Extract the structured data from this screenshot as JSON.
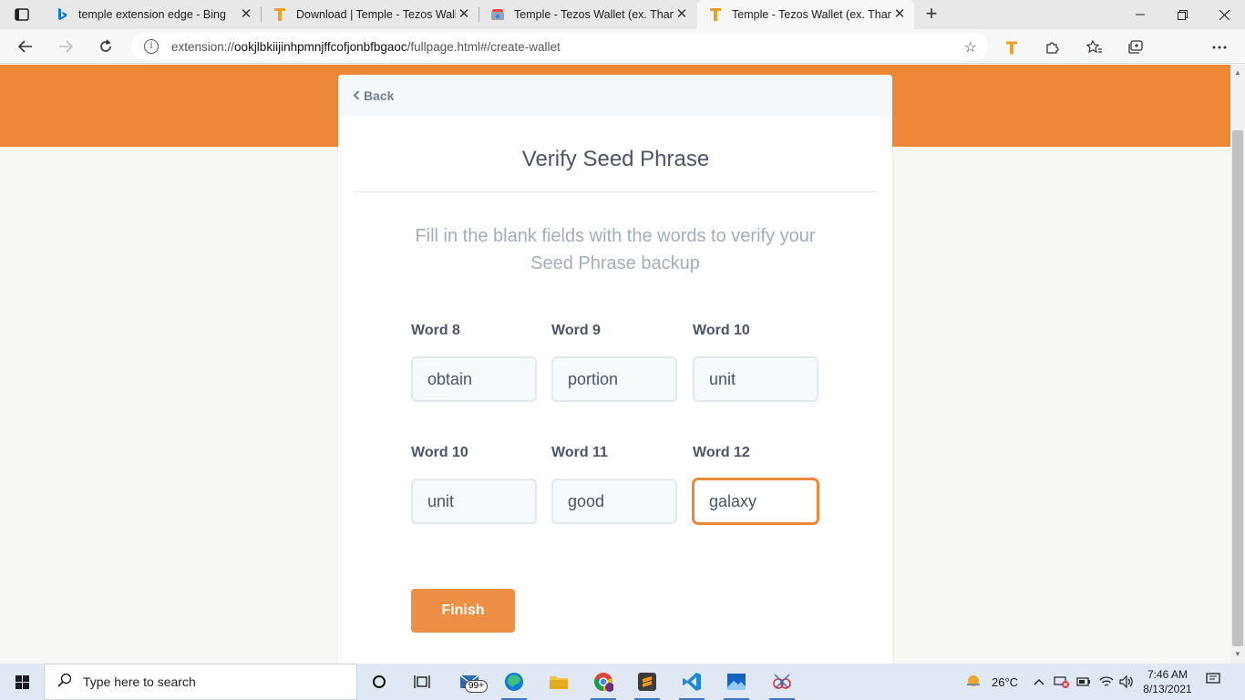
{
  "browser": {
    "tabs": [
      {
        "title": "temple extension edge - Bing",
        "icon": "bing-icon"
      },
      {
        "title": "Download | Temple - Tezos Walle",
        "icon": "temple-icon"
      },
      {
        "title": "Temple - Tezos Wallet (ex. Thano",
        "icon": "chrome-web-store-icon"
      },
      {
        "title": "Temple - Tezos Wallet (ex. Thano",
        "icon": "temple-icon"
      }
    ],
    "address": {
      "prefix": "extension://",
      "host": "ookjlbkiijinhpmnjffcofjonbfbgaoc",
      "path": "/fullpage.html#/create-wallet"
    }
  },
  "app": {
    "back_label": "Back",
    "title": "Verify Seed Phrase",
    "description": "Fill in the blank fields with the words to verify your Seed Phrase backup",
    "fields": [
      {
        "label": "Word 8",
        "value": "obtain"
      },
      {
        "label": "Word 9",
        "value": "portion"
      },
      {
        "label": "Word 10",
        "value": "unit"
      },
      {
        "label": "Word 10",
        "value": "unit"
      },
      {
        "label": "Word 11",
        "value": "good"
      },
      {
        "label": "Word 12",
        "value": "galaxy"
      }
    ],
    "finish_label": "Finish",
    "colors": {
      "accent": "#ed8936",
      "button": "#ed9045",
      "text": "#4a5568",
      "muted": "#a0aec0"
    }
  },
  "taskbar": {
    "search_placeholder": "Type here to search",
    "mail_badge": "99+",
    "temperature": "26°C",
    "time": "7:46 AM",
    "date": "8/13/2021"
  }
}
